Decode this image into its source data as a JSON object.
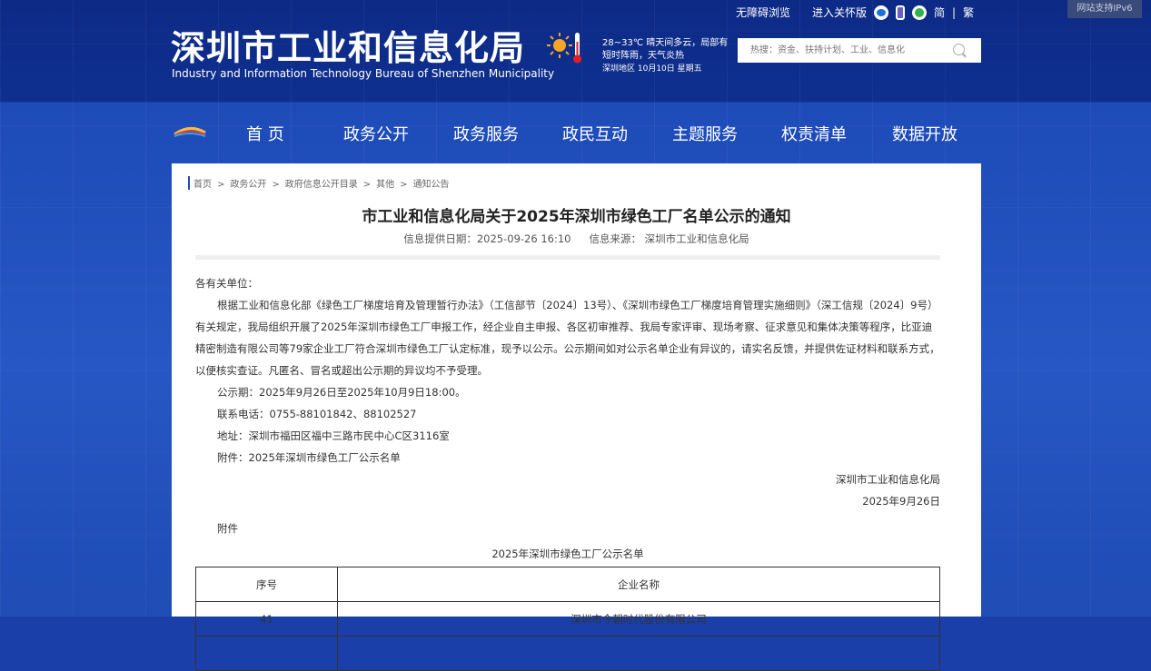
{
  "ipv6": "网站支持IPv6",
  "header": {
    "title_cn": "深圳市工业和信息化局",
    "title_en": "Industry and Information Technology Bureau of Shenzhen Municipality",
    "weather_line1": "28~33℃  晴天间多云，局部有",
    "weather_line2": "短时阵雨，天气炎热",
    "weather_line3": "深圳地区  10月10日  星期五",
    "links": {
      "accessible": "无障碍浏览",
      "elderly": "进入关怀版",
      "simp": "简",
      "sep": "|",
      "trad": "繁"
    },
    "search_placeholder": "热搜：资金、扶持计划、工业、信息化"
  },
  "nav": [
    "首 页",
    "政务公开",
    "政务服务",
    "政民互动",
    "主题服务",
    "权责清单",
    "数据开放"
  ],
  "breadcrumb": [
    "首页",
    "政务公开",
    "政府信息公开目录",
    "其他",
    "通知公告"
  ],
  "breadcrumb_sep": ">",
  "article": {
    "title": "市工业和信息化局关于2025年深圳市绿色工厂名单公示的通知",
    "date": "信息提供日期：2025-09-26 16:10",
    "source": "信息来源：  深圳市工业和信息化局",
    "greeting": "各有关单位：",
    "para": "根据工业和信息化部《绿色工厂梯度培育及管理暂行办法》（工信部节〔2024〕13号）、《深圳市绿色工厂梯度培育管理实施细则》（深工信规〔2024〕9号）有关规定，我局组织开展了2025年深圳市绿色工厂申报工作，经企业自主申报、各区初审推荐、我局专家评审、现场考察、征求意见和集体决策等程序，比亚迪精密制造有限公司等79家企业工厂符合深圳市绿色工厂认定标准，现予以公示。公示期间如对公示名单企业有异议的，请实名反馈，并提供佐证材料和联系方式，以便核实查证。凡匿名、冒名或超出公示期的异议均不予受理。",
    "period": "公示期：2025年9月26日至2025年10月9日18:00。",
    "phone": "联系电话：0755-88101842、88102527",
    "address": "地址：深圳市福田区福中三路市民中心C区3116室",
    "attachment": "附件：2025年深圳市绿色工厂公示名单",
    "sign_org": "深圳市工业和信息化局",
    "sign_date": "2025年9月26日",
    "attach_label": "附件",
    "table_title": "2025年深圳市绿色工厂公示名单",
    "table_headers": [
      "序号",
      "企业名称"
    ],
    "rows": [
      [
        "41",
        "深圳市今朝时代股份有限公司"
      ]
    ]
  }
}
